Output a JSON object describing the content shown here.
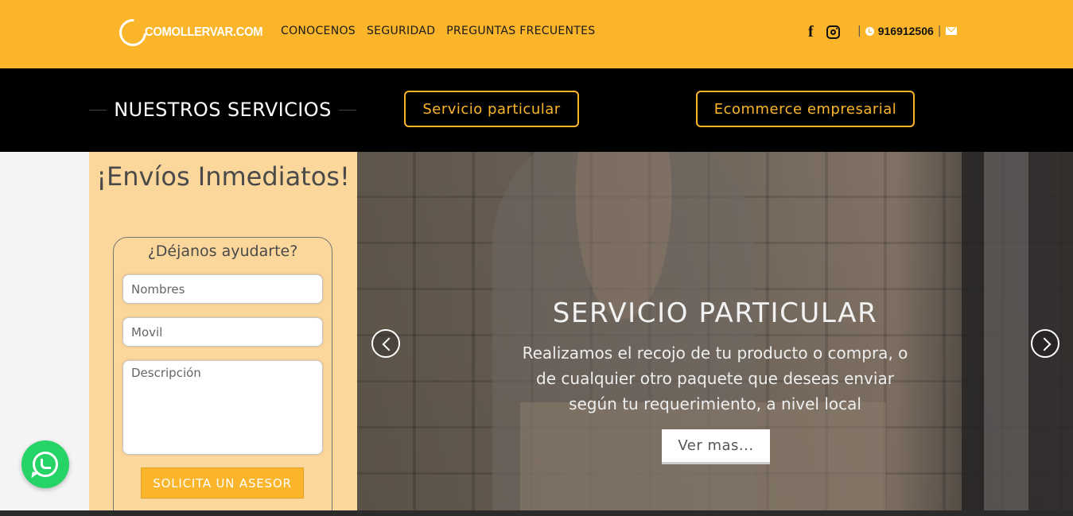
{
  "header": {
    "logo_text": "COMOLLERVAR.COM",
    "nav": [
      "CONOCENOS",
      "SEGURIDAD",
      "PREGUNTAS FRECUENTES"
    ],
    "separator": "|",
    "phone": "916912506",
    "icons": [
      "facebook-icon",
      "instagram-icon",
      "phone-icon",
      "mail-icon"
    ]
  },
  "services": {
    "title": "NUESTROS SERVICIOS",
    "buttons": [
      "Servicio particular",
      "Ecommerce empresarial"
    ]
  },
  "form_panel": {
    "title": "¡Envíos Inmediatos!",
    "subtitle": "¿Déjanos ayudarte?",
    "name_placeholder": "Nombres",
    "phone_placeholder": "Movil",
    "description_placeholder": "Descripción",
    "submit_label": "SOLICITA UN ASESOR"
  },
  "hero": {
    "title": "SERVICIO PARTICULAR",
    "text": "Realizamos el recojo de tu producto o compra, o de cualquier otro paquete que deseas enviar según tu requerimiento, a nivel local",
    "button_label": "Ver mas..."
  },
  "colors": {
    "brand_yellow": "#fbb52a",
    "panel_bg": "#fbd79b",
    "band_bg": "#000000",
    "whatsapp_green": "#25d366"
  }
}
